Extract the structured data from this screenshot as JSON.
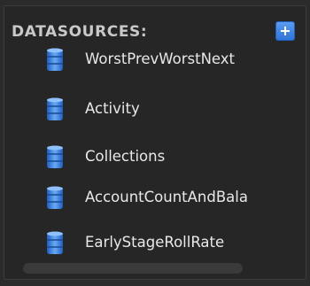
{
  "panel": {
    "title": "DATASOURCES:",
    "add_button_label": "+",
    "datasources": [
      {
        "label": "WorstPrevWorstNext",
        "icon": "database-icon"
      },
      {
        "label": "Activity",
        "icon": "database-icon"
      },
      {
        "label": "Collections",
        "icon": "database-icon"
      },
      {
        "label": "AccountCountAndBala",
        "icon": "database-icon"
      },
      {
        "label": "EarlyStageRollRate",
        "icon": "database-icon"
      }
    ]
  },
  "colors": {
    "background": "#262626",
    "header_text": "#c9c9c9",
    "item_text": "#e8e8e8",
    "accent_blue": "#3f86e6",
    "scrollbar": "#3a3a3a"
  }
}
